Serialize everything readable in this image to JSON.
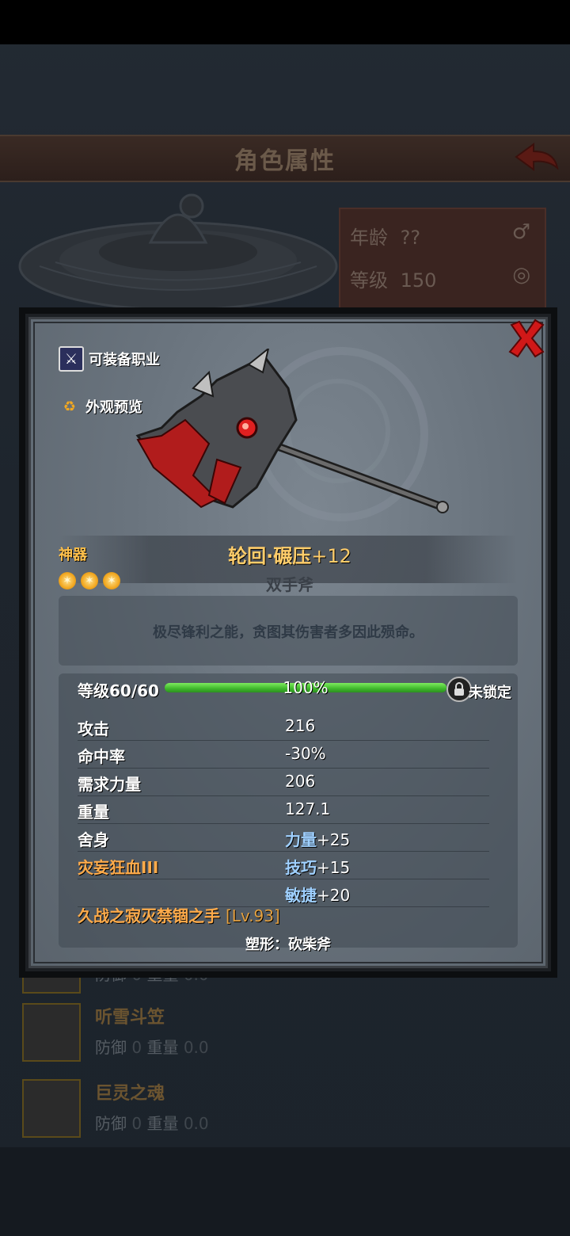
{
  "background": {
    "title": "角色属性",
    "info": {
      "age_label": "年龄",
      "age_value": "??",
      "level_label": "等级",
      "level_value": "150",
      "gender_icon": "male-icon",
      "ring_icon": "ring-icon"
    },
    "items": [
      {
        "name": "",
        "stats_def_label": "防御",
        "stats_def": "0",
        "stats_weight_label": "重量",
        "stats_weight": "0.0"
      },
      {
        "name": "听雪斗笠",
        "stats_def_label": "防御",
        "stats_def": "0",
        "stats_weight_label": "重量",
        "stats_weight": "0.0"
      },
      {
        "name": "巨灵之魂",
        "stats_def_label": "防御",
        "stats_def": "0",
        "stats_weight_label": "重量",
        "stats_weight": "0.0"
      }
    ]
  },
  "modal": {
    "equip_class_label": "可装备职业",
    "appearance_label": "外观预览",
    "rarity": "神器",
    "stars": 3,
    "name": "轮回·碾压",
    "enhance": "+12",
    "type": "双手斧",
    "description": "极尽锋利之能，贪图其伤害者多因此殒命。",
    "level_label": "等级60/60",
    "level_progress_pct": "100%",
    "level_progress": 1.0,
    "lock_label": "未锁定",
    "stats": [
      {
        "label": "攻击",
        "value": "216"
      },
      {
        "label": "命中率",
        "value": "-30%"
      },
      {
        "label": "需求力量",
        "value": "206"
      },
      {
        "label": "重量",
        "value": "127.1"
      }
    ],
    "skills": [
      {
        "label": "舍身",
        "attr": "力量",
        "bonus": "+25"
      },
      {
        "label": "灾妄狂血III",
        "attr": "技巧",
        "bonus": "+15"
      },
      {
        "label": "",
        "attr": "敏捷",
        "bonus": "+20"
      }
    ],
    "set_name": "久战之寂灭禁锢之手",
    "set_level": "[Lv.93]",
    "reshape": "塑形：砍柴斧"
  },
  "colors": {
    "rarity": "#ffc04a",
    "name": "#ffcd6a",
    "skill_orange": "#ffab4a",
    "bonus_blue": "#9fd0ff",
    "progress_green": "#3fb82c",
    "close_red": "#d01818"
  }
}
